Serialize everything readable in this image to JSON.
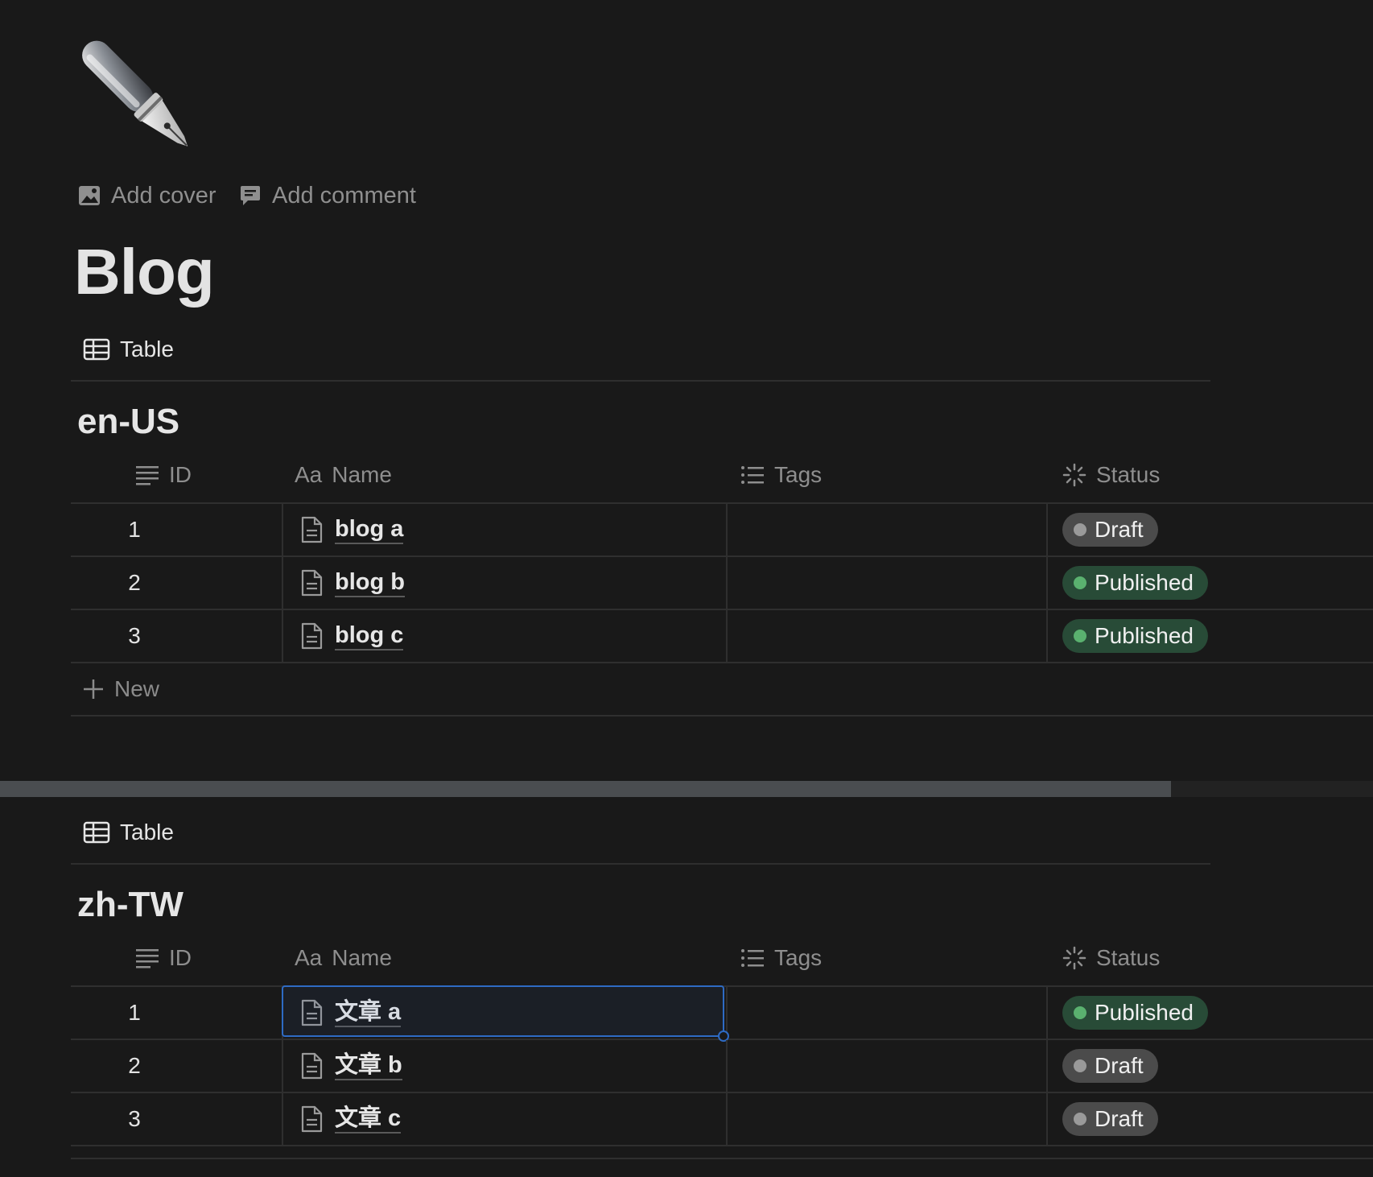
{
  "page": {
    "title": "Blog",
    "icon": "fountain-pen-icon",
    "add_cover_label": "Add cover",
    "add_comment_label": "Add comment"
  },
  "columns": {
    "id": "ID",
    "name_prefix": "Aa",
    "name": "Name",
    "tags": "Tags",
    "status": "Status"
  },
  "databases": [
    {
      "view_label": "Table",
      "title": "en-US",
      "new_label": "New",
      "rows": [
        {
          "id": "1",
          "name": "blog a",
          "tags": "",
          "status": "Draft"
        },
        {
          "id": "2",
          "name": "blog b",
          "tags": "",
          "status": "Published"
        },
        {
          "id": "3",
          "name": "blog c",
          "tags": "",
          "status": "Published"
        }
      ]
    },
    {
      "view_label": "Table",
      "title": "zh-TW",
      "rows": [
        {
          "id": "1",
          "name": "文章 a",
          "tags": "",
          "status": "Published"
        },
        {
          "id": "2",
          "name": "文章 b",
          "tags": "",
          "status": "Draft"
        },
        {
          "id": "3",
          "name": "文章 c",
          "tags": "",
          "status": "Draft"
        }
      ]
    }
  ],
  "colors": {
    "background": "#191919",
    "draft_pill": "#4b4b4b",
    "published_pill": "#284b37",
    "published_dot": "#5ab16f",
    "selection": "#2e6bc4"
  }
}
